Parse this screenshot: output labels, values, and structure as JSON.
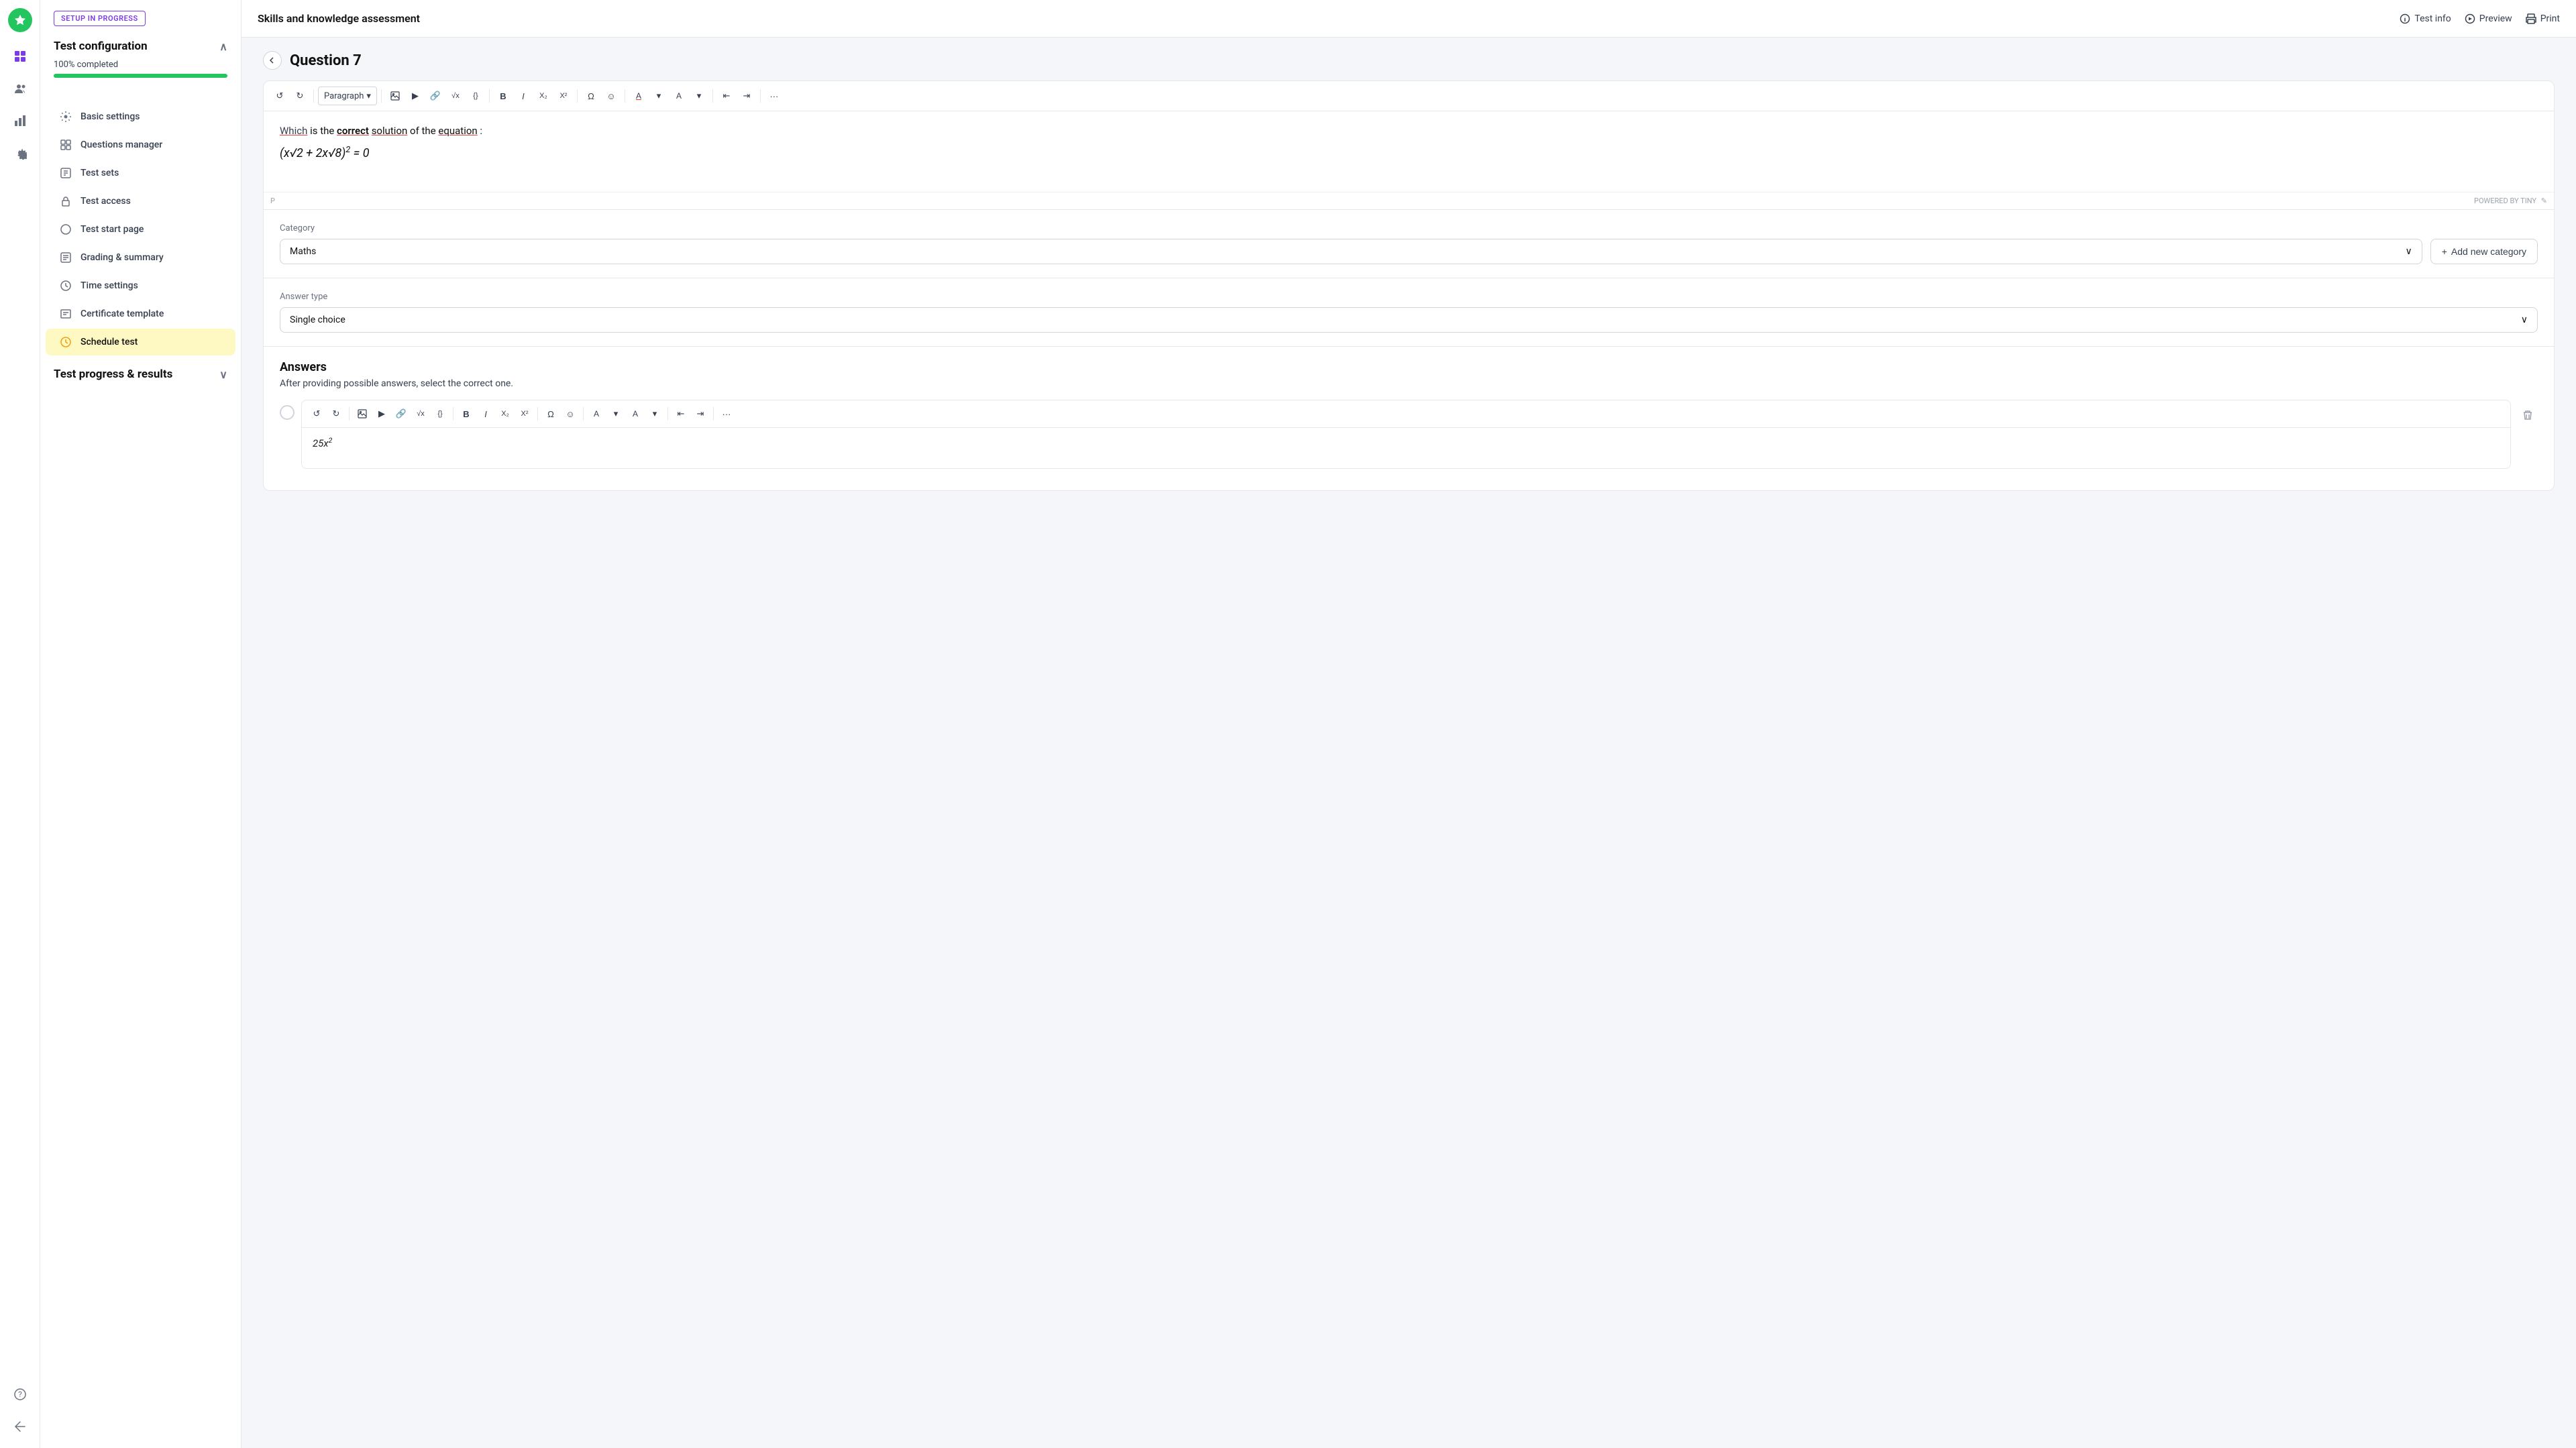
{
  "app": {
    "logo_alt": "Logo",
    "title": "Skills and knowledge assessment"
  },
  "icon_bar": {
    "icons": [
      {
        "name": "grid-icon",
        "symbol": "⊞",
        "active": true
      },
      {
        "name": "users-icon",
        "symbol": "👥",
        "active": false
      },
      {
        "name": "chart-icon",
        "symbol": "📊",
        "active": false
      },
      {
        "name": "settings-icon",
        "symbol": "⚙",
        "active": false
      },
      {
        "name": "help-icon",
        "symbol": "?",
        "active": false
      },
      {
        "name": "back-icon",
        "symbol": "↩",
        "active": false
      }
    ]
  },
  "sidebar": {
    "status_badge": "SETUP IN PROGRESS",
    "test_config": {
      "title": "Test configuration",
      "progress_label": "100% completed",
      "progress_value": 100,
      "items": [
        {
          "id": "basic-settings",
          "label": "Basic settings",
          "icon": "⚙",
          "active": false
        },
        {
          "id": "questions-manager",
          "label": "Questions manager",
          "icon": "☰",
          "active": false
        },
        {
          "id": "test-sets",
          "label": "Test sets",
          "icon": "⊞",
          "active": false
        },
        {
          "id": "test-access",
          "label": "Test access",
          "icon": "🔒",
          "active": false
        },
        {
          "id": "test-start-page",
          "label": "Test start page",
          "icon": "○",
          "active": false
        },
        {
          "id": "grading-summary",
          "label": "Grading & summary",
          "icon": "📋",
          "active": false
        },
        {
          "id": "time-settings",
          "label": "Time settings",
          "icon": "◷",
          "active": false
        },
        {
          "id": "certificate-template",
          "label": "Certificate template",
          "icon": "📜",
          "active": false
        },
        {
          "id": "schedule-test",
          "label": "Schedule test",
          "icon": "⏰",
          "active": true
        }
      ]
    },
    "test_progress": {
      "title": "Test progress & results"
    }
  },
  "top_bar": {
    "title": "Skills and knowledge assessment",
    "actions": [
      {
        "id": "test-info",
        "label": "Test info",
        "icon": "ℹ"
      },
      {
        "id": "preview",
        "label": "Preview",
        "icon": "▶"
      },
      {
        "id": "print",
        "label": "Print",
        "icon": "🖨"
      }
    ]
  },
  "question": {
    "back_label": "‹",
    "title": "Question 7",
    "toolbar_paragraph_label": "Paragraph",
    "question_text": "Which is the correct solution of the equation:",
    "question_math": "(x√2 + 2x√8)² = 0",
    "editor_footer_left": "P",
    "editor_footer_right": "POWERED BY TINY",
    "category": {
      "label": "Category",
      "value": "Maths",
      "add_label": "+ Add new category"
    },
    "answer_type": {
      "label": "Answer type",
      "value": "Single choice"
    },
    "answers": {
      "title": "Answers",
      "hint": "After providing possible answers, select the correct one.",
      "items": [
        {
          "id": "answer-1",
          "math": "25x²",
          "checked": false
        }
      ]
    }
  },
  "colors": {
    "accent": "#7c3aed",
    "progress_green": "#22c55e",
    "schedule_yellow": "#fef9c3",
    "schedule_icon": "#f59e0b"
  }
}
